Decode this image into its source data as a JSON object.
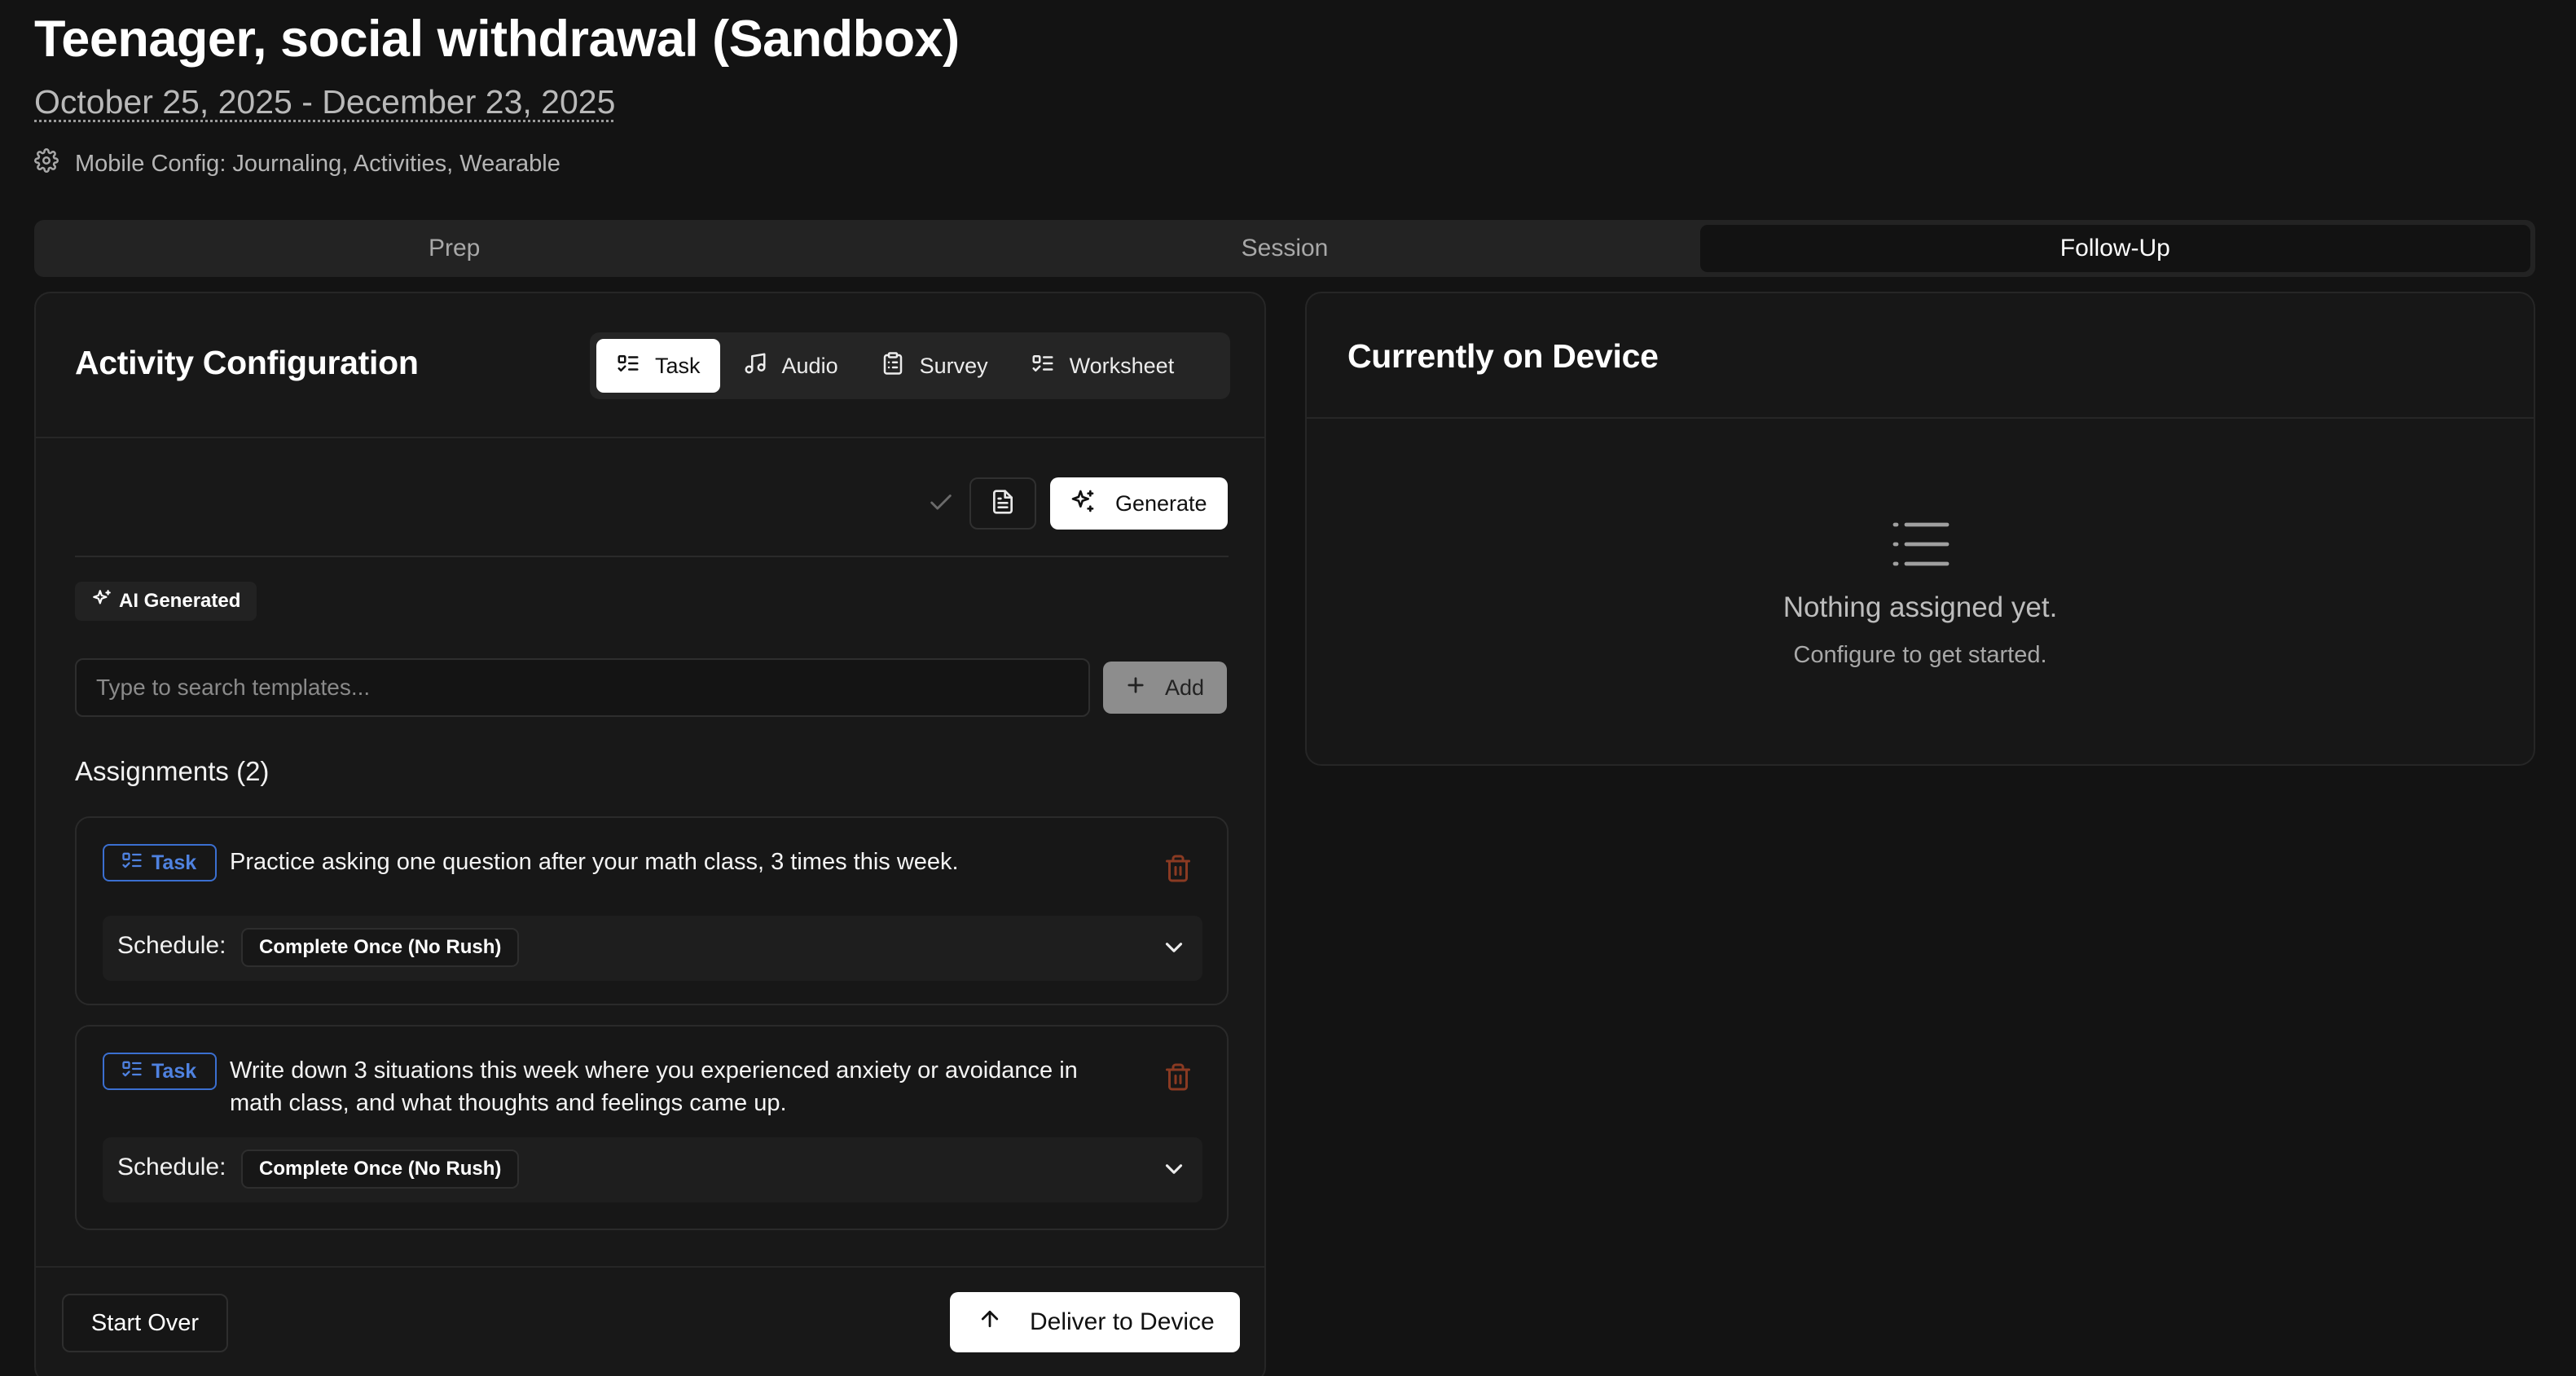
{
  "header": {
    "title": "Teenager, social withdrawal (Sandbox)",
    "date_range": "October 25, 2025 - December 23, 2025",
    "mobile_config": "Mobile Config: Journaling, Activities, Wearable"
  },
  "tabs": [
    {
      "label": "Prep"
    },
    {
      "label": "Session"
    },
    {
      "label": "Follow-Up",
      "active": true
    }
  ],
  "activity_config": {
    "title": "Activity Configuration",
    "types": [
      {
        "label": "Task",
        "icon": "task-list-icon",
        "active": true
      },
      {
        "label": "Audio",
        "icon": "music-note-icon"
      },
      {
        "label": "Survey",
        "icon": "clipboard-icon"
      },
      {
        "label": "Worksheet",
        "icon": "task-list-icon"
      }
    ],
    "generate_label": "Generate",
    "ai_badge": "AI Generated",
    "search_placeholder": "Type to search templates...",
    "add_label": "Add",
    "assignments_heading": "Assignments (2)",
    "assignments": [
      {
        "tag": "Task",
        "text": "Practice asking one question after your math class, 3 times this week.",
        "schedule_label": "Schedule:",
        "schedule_value": "Complete Once (No Rush)"
      },
      {
        "tag": "Task",
        "text": "Write down 3 situations this week where you experienced anxiety or avoidance in math class, and what thoughts and feelings came up.",
        "schedule_label": "Schedule:",
        "schedule_value": "Complete Once (No Rush)"
      }
    ],
    "start_over_label": "Start Over",
    "deliver_label": "Deliver to Device"
  },
  "device": {
    "title": "Currently on Device",
    "empty_main": "Nothing assigned yet.",
    "empty_sub": "Configure to get started."
  },
  "colors": {
    "background": "#131313",
    "accent_blue": "#4f82e0",
    "trash_red": "#8a3a22"
  }
}
